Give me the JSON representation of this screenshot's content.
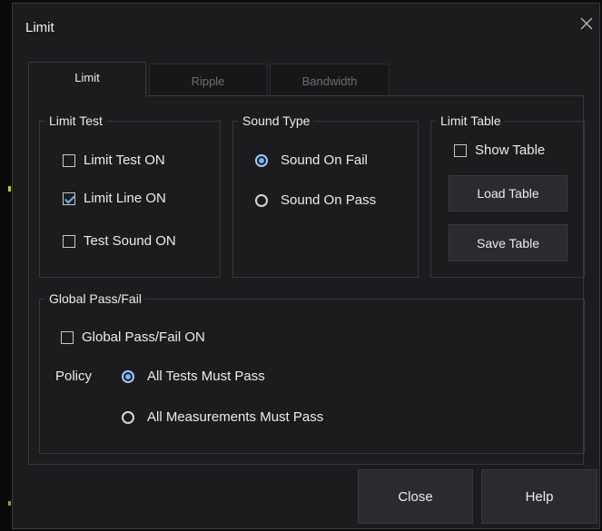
{
  "window": {
    "title": "Limit"
  },
  "tabs": [
    {
      "label": "Limit",
      "active": true
    },
    {
      "label": "Ripple",
      "active": false
    },
    {
      "label": "Bandwidth",
      "active": false
    }
  ],
  "limit_test": {
    "legend": "Limit Test",
    "limit_test_on": {
      "label": "Limit Test ON",
      "checked": false
    },
    "limit_line_on": {
      "label": "Limit Line ON",
      "checked": true
    },
    "test_sound_on": {
      "label": "Test Sound ON",
      "checked": false
    }
  },
  "sound_type": {
    "legend": "Sound Type",
    "sound_on_fail": {
      "label": "Sound On Fail",
      "selected": true
    },
    "sound_on_pass": {
      "label": "Sound On Pass",
      "selected": false
    }
  },
  "limit_table": {
    "legend": "Limit Table",
    "show_table": {
      "label": "Show Table",
      "checked": false
    },
    "load_label": "Load Table",
    "save_label": "Save Table"
  },
  "global_pass_fail": {
    "legend": "Global Pass/Fail",
    "on": {
      "label": "Global Pass/Fail ON",
      "checked": false
    },
    "policy_label": "Policy",
    "all_tests": {
      "label": "All Tests Must Pass",
      "selected": true
    },
    "all_measurements": {
      "label": "All Measurements Must Pass",
      "selected": false
    }
  },
  "footer": {
    "close_label": "Close",
    "help_label": "Help"
  },
  "colors": {
    "accent": "#6fb3ff",
    "dialog_bg": "#1c1c1f",
    "border": "#3a3a3e"
  }
}
